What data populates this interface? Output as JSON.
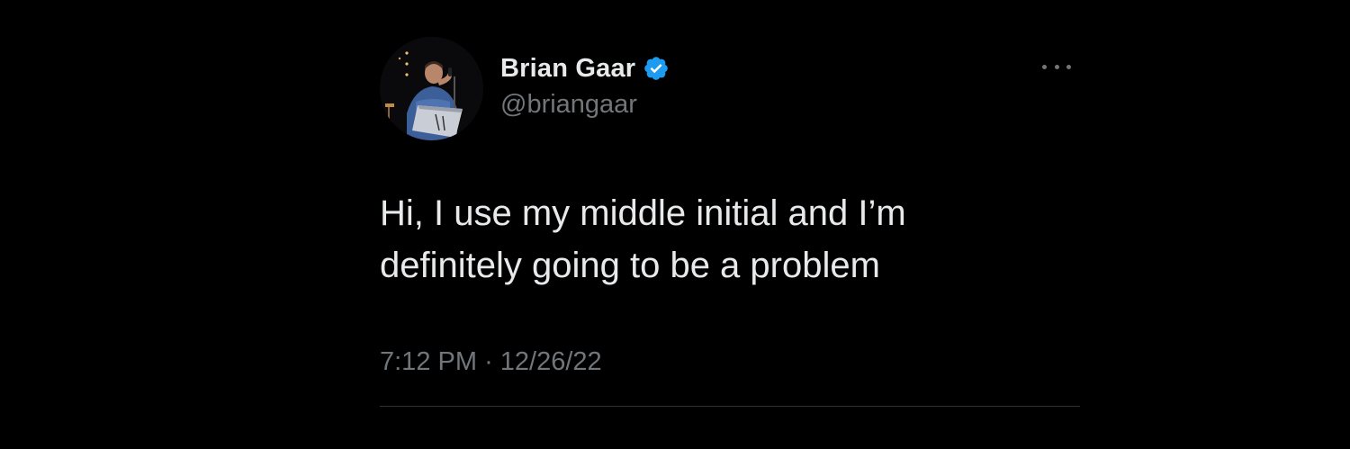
{
  "tweet": {
    "display_name": "Brian Gaar",
    "handle": "@briangaar",
    "verified": true,
    "text_line1": "Hi, I use my middle initial and I’m",
    "text_line2": "definitely going to be a problem",
    "time": "7:12 PM",
    "separator": "·",
    "date": "12/26/22"
  },
  "icons": {
    "verified": "verified-badge-icon",
    "more": "more-options-icon"
  },
  "colors": {
    "background": "#000000",
    "primary_text": "#e7e9ea",
    "secondary_text": "#71767b",
    "verified_blue": "#1d9bf0"
  }
}
